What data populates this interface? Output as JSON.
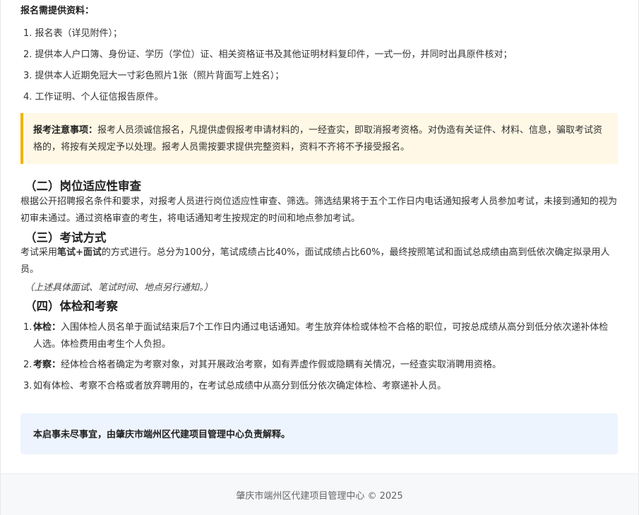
{
  "requirements": {
    "title": "报名需提供资料：",
    "items": [
      "1. 报名表（详见附件）；",
      "2. 提供本人户口簿、身份证、学历（学位）证、相关资格证书及其他证明材料复印件，一式一份，并同时出具原件核对；",
      "3. 提供本人近期免冠大一寸彩色照片1张（照片背面写上姓名）；",
      "4. 工作证明、个人征信报告原件。"
    ]
  },
  "notice": {
    "label": "报考注意事项：",
    "text": "报考人员须诚信报名，凡提供虚假报考申请材料的，一经查实，即取消报考资格。对伪造有关证件、材料、信息，骗取考试资格的，将按有关规定予以处理。报考人员需按要求提供完整资料，资料不齐将不予接受报名。"
  },
  "section2": {
    "heading": "（二）岗位适应性审查",
    "body": "根据公开招聘报名条件和要求，对报考人员进行岗位适应性审查、筛选。筛选结果将于五个工作日内电话通知报考人员参加考试，未接到通知的视为初审未通过。通过资格审查的考生，将电话通知考生按规定的时间和地点参加考试。"
  },
  "section3": {
    "heading": "（三）考试方式",
    "body_pre": "考试采用",
    "body_bold": "笔试+面试",
    "body_post": "的方式进行。总分为100分，笔试成绩占比40%，面试成绩占比60%，最终按照笔试和面试总成绩由高到低依次确定拟录用人员。",
    "note": "（上述具体面试、笔试时间、地点另行通知。）"
  },
  "section4": {
    "heading": "（四）体检和考察",
    "items": [
      {
        "num": "1.",
        "label": "体检：",
        "text": "入围体检人员名单于面试结束后7个工作日内通过电话通知。考生放弃体检或体检不合格的职位，可按总成绩从高分到低分依次递补体检人选。体检费用由考生个人负担。"
      },
      {
        "num": "2.",
        "label": "考察：",
        "text": "经体检合格者确定为考察对象，对其开展政治考察，如有弄虚作假或隐瞒有关情况，一经查实取消聘用资格。"
      },
      {
        "num": "3.",
        "label": "",
        "text": "如有体检、考察不合格或者放弃聘用的，在考试总成绩中从高分到低分依次确定体检、考察递补人员。"
      }
    ]
  },
  "final_statement": "本启事未尽事宜，由肇庆市端州区代建项目管理中心负责解释。",
  "footer": "肇庆市端州区代建项目管理中心 © 2025",
  "colors": {
    "notice_bg": "#fff8e6",
    "notice_border": "#f2b400",
    "final_bg": "#eef4fd",
    "footer_bg": "#f7f8fa"
  }
}
